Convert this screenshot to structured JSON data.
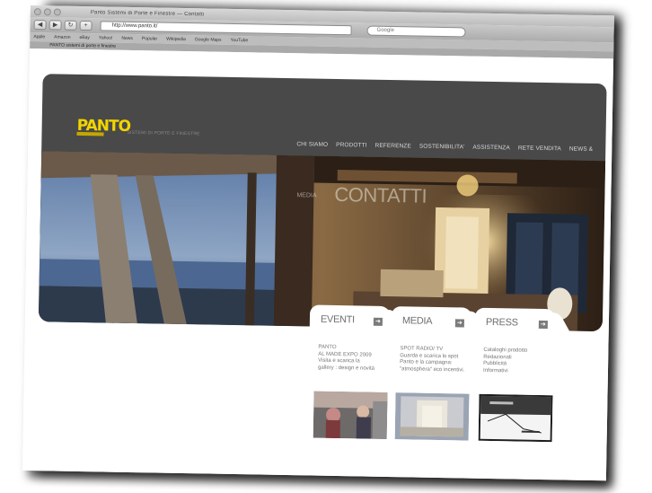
{
  "browser": {
    "title": "Panto Sistemi di Porte e Finestre — Contatti",
    "url": "http://www.panto.it/",
    "search_placeholder": "Google",
    "bookmarks": [
      "Apple",
      "Amazon",
      "eBay",
      "Yahoo!",
      "News",
      "Popular",
      "Wikipedia",
      "Google Maps",
      "YouTube"
    ],
    "tab_label": "PANTO sistemi di porte e finestre"
  },
  "site": {
    "logo": "PANTO",
    "tagline": "SISTEMI DI PORTE E FINESTRE",
    "nav": [
      "CHI SIAMO",
      "PRODOTTI",
      "REFERENZE",
      "SOSTENIBILITA'",
      "ASSISTENZA",
      "RETE VENDITA",
      "NEWS &"
    ],
    "hero_title": "CONTATTI",
    "hero_small": "MEDIA",
    "panels": [
      {
        "title": "EVENTI",
        "lines": [
          "PANTO",
          "AL MADE EXPO 2009",
          "Visita e scarica la",
          "gallery : design e novità"
        ]
      },
      {
        "title": "MEDIA",
        "lines": [
          "SPOT RADIO/ TV",
          "Guarda e scarica lo spot",
          "Panto e la campagna:",
          "\"atmosphera\" eco incentivi."
        ]
      },
      {
        "title": "PRESS",
        "lines": [
          "Cataloghi prodotto",
          "Redazionali",
          "Pubblicità",
          "Informativi"
        ]
      }
    ]
  },
  "colors": {
    "header_bg": "#494949",
    "logo": "#f2d500",
    "panel_arrow": "#7b7b7b"
  }
}
